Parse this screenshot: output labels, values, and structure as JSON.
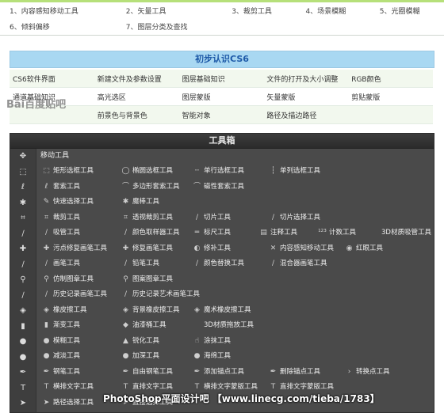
{
  "top_list": {
    "row1": [
      "1、内容感知移动工具",
      "2、矢量工具",
      "3、裁剪工具",
      "4、场景模糊",
      "5、光圈模糊"
    ],
    "row2": [
      "6、倾斜偏移",
      "7、图层分类及查找"
    ]
  },
  "banner_title": "初步认识CS6",
  "topics": [
    [
      "CS6软件界面",
      "新建文件及参数设置",
      "图层基础知识",
      "文件的打开及大小调整",
      "RGB颜色"
    ],
    [
      "通道基础知识",
      "高光选区",
      "图层蒙版",
      "矢量蒙版",
      "剪贴蒙版"
    ],
    [
      "",
      "前景色与背景色",
      "智能对象",
      "路径及描边路径",
      ""
    ]
  ],
  "watermark_text": "Bai百度贴吧",
  "toolbox": {
    "title": "工具箱",
    "group_label": "移动工具",
    "rows": [
      [
        {
          "icon": "⬚",
          "label": "矩形选框工具"
        },
        {
          "icon": "◯",
          "label": "椭圆选框工具"
        },
        {
          "icon": "┄",
          "label": "单行选框工具"
        },
        {
          "icon": "┆",
          "label": "单列选框工具"
        }
      ],
      [
        {
          "icon": "ℓ",
          "label": "套索工具"
        },
        {
          "icon": "⌒",
          "label": "多边形套索工具"
        },
        {
          "icon": "⌒",
          "label": "磁性套索工具"
        }
      ],
      [
        {
          "icon": "✎",
          "label": "快速选择工具"
        },
        {
          "icon": "✱",
          "label": "魔棒工具"
        }
      ],
      [
        {
          "icon": "⌗",
          "label": "裁剪工具"
        },
        {
          "icon": "⌗",
          "label": "透视裁剪工具"
        },
        {
          "icon": "∕",
          "label": "切片工具"
        },
        {
          "icon": "∕",
          "label": "切片选择工具"
        }
      ],
      [
        {
          "icon": "∕",
          "label": "吸管工具"
        },
        {
          "icon": "∕",
          "label": "颜色取样器工具"
        },
        {
          "icon": "═",
          "label": "标尺工具"
        },
        {
          "icon": "▤",
          "label": "注释工具"
        },
        {
          "icon": "¹²³",
          "label": "计数工具"
        },
        {
          "icon": "",
          "label": "3D材质吸管工具"
        }
      ],
      [
        {
          "icon": "✚",
          "label": "污点修复画笔工具"
        },
        {
          "icon": "✚",
          "label": "修复画笔工具"
        },
        {
          "icon": "◐",
          "label": "修补工具"
        },
        {
          "icon": "✕",
          "label": "内容感知移动工具"
        },
        {
          "icon": "◉",
          "label": "红眼工具"
        }
      ],
      [
        {
          "icon": "∕",
          "label": "画笔工具"
        },
        {
          "icon": "∕",
          "label": "铅笔工具"
        },
        {
          "icon": "∕",
          "label": "颜色替换工具"
        },
        {
          "icon": "∕",
          "label": "混合器画笔工具"
        }
      ],
      [
        {
          "icon": "⚲",
          "label": "仿制图章工具"
        },
        {
          "icon": "⚲",
          "label": "图案图章工具"
        }
      ],
      [
        {
          "icon": "∕",
          "label": "历史记录画笔工具"
        },
        {
          "icon": "∕",
          "label": "历史记录艺术画笔工具"
        }
      ],
      [
        {
          "icon": "◈",
          "label": "橡皮擦工具"
        },
        {
          "icon": "◈",
          "label": "背景橡皮擦工具"
        },
        {
          "icon": "◈",
          "label": "魔术橡皮擦工具"
        }
      ],
      [
        {
          "icon": "▮",
          "label": "渐变工具"
        },
        {
          "icon": "◆",
          "label": "油漆桶工具"
        },
        {
          "icon": "",
          "label": "3D材质拖放工具"
        }
      ],
      [
        {
          "icon": "●",
          "label": "模糊工具"
        },
        {
          "icon": "▲",
          "label": "锐化工具"
        },
        {
          "icon": "☝",
          "label": "涂抹工具"
        }
      ],
      [
        {
          "icon": "●",
          "label": "减淡工具"
        },
        {
          "icon": "●",
          "label": "加深工具"
        },
        {
          "icon": "●",
          "label": "海绵工具"
        }
      ],
      [
        {
          "icon": "✒",
          "label": "钢笔工具"
        },
        {
          "icon": "✒",
          "label": "自由钢笔工具"
        },
        {
          "icon": "✒",
          "label": "添加锚点工具"
        },
        {
          "icon": "✒",
          "label": "删除锚点工具"
        },
        {
          "icon": "›",
          "label": "转换点工具"
        }
      ],
      [
        {
          "icon": "T",
          "label": "横排文字工具"
        },
        {
          "icon": "T",
          "label": "直排文字工具"
        },
        {
          "icon": "T",
          "label": "横排文字蒙版工具"
        },
        {
          "icon": "T",
          "label": "直排文字蒙版工具"
        }
      ],
      [
        {
          "icon": "➤",
          "label": "路径选择工具"
        },
        {
          "icon": "➤",
          "label": "直接选择工具"
        }
      ]
    ],
    "sidebar_icons": [
      "✥",
      "⬚",
      "ℓ",
      "✱",
      "⌗",
      "∕",
      "✚",
      "∕",
      "⚲",
      "∕",
      "◈",
      "▮",
      "●",
      "●",
      "✒",
      "T",
      "➤"
    ]
  },
  "footer_watermark": "PhotoShop平面设计吧 【www.linecg.com/tieba/1783】"
}
